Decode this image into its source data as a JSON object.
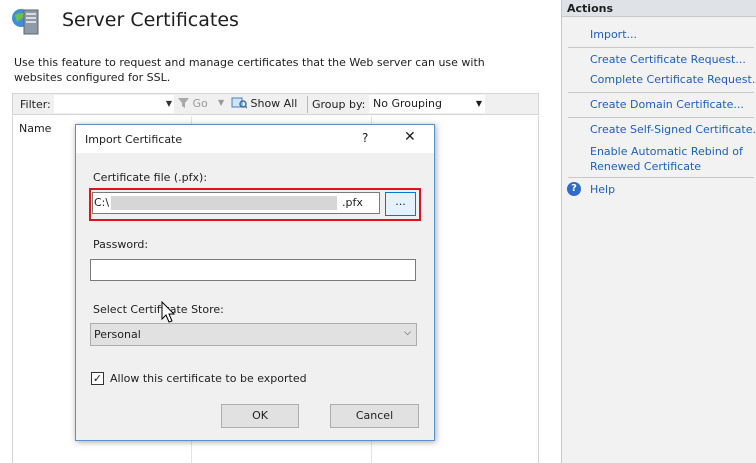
{
  "page": {
    "title": "Server Certificates",
    "description": "Use this feature to request and manage certificates that the Web server can use with websites configured for SSL."
  },
  "toolbar": {
    "filter_label": "Filter:",
    "filter_value": "",
    "go_label": "Go",
    "show_all_label": "Show All",
    "group_by_label": "Group by:",
    "group_by_value": "No Grouping"
  },
  "grid": {
    "columns": [
      "Name"
    ]
  },
  "actions": {
    "header": "Actions",
    "items": [
      "Import...",
      "Create Certificate Request...",
      "Complete Certificate Request...",
      "Create Domain Certificate...",
      "Create Self-Signed Certificate...",
      "Enable Automatic Rebind of",
      "Renewed Certificate",
      "Help"
    ]
  },
  "dialog": {
    "title": "Import Certificate",
    "help_symbol": "?",
    "close_symbol": "✕",
    "cert_file_label": "Certificate file (.pfx):",
    "cert_file_prefix": "C:\\",
    "cert_file_suffix": ".pfx",
    "browse_label": "...",
    "password_label": "Password:",
    "password_value": "",
    "store_label": "Select Certificate Store:",
    "store_value": "Personal",
    "export_checked": true,
    "export_label": "Allow this certificate to be exported",
    "ok_label": "OK",
    "cancel_label": "Cancel"
  },
  "colors": {
    "link": "#1c5ec0",
    "highlight": "#e0121a",
    "dialog_border": "#5a8fd3"
  }
}
